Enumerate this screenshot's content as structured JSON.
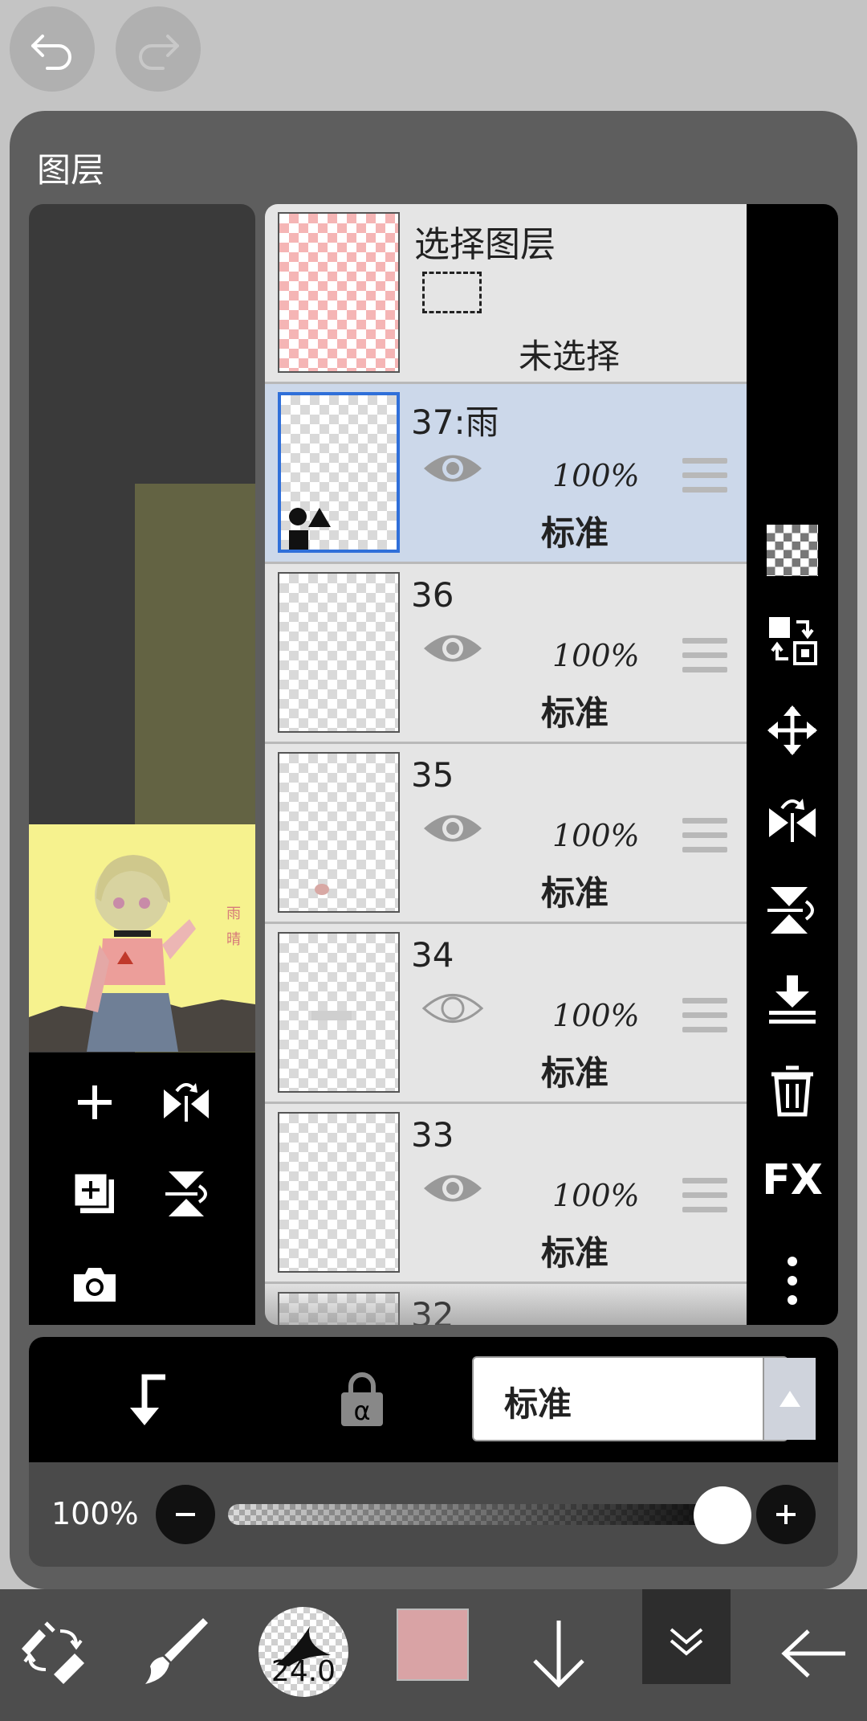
{
  "header": {
    "undo_icon": "undo-icon",
    "redo_icon": "redo-icon"
  },
  "panel": {
    "title": "图层"
  },
  "selection_layer": {
    "title": "选择图层",
    "status": "未选择"
  },
  "layers": [
    {
      "name": "37:雨",
      "opacity": "100%",
      "mode": "标准",
      "visible": true,
      "selected": true
    },
    {
      "name": "36",
      "opacity": "100%",
      "mode": "标准",
      "visible": true,
      "selected": false
    },
    {
      "name": "35",
      "opacity": "100%",
      "mode": "标准",
      "visible": true,
      "selected": false
    },
    {
      "name": "34",
      "opacity": "100%",
      "mode": "标准",
      "visible": false,
      "selected": false
    },
    {
      "name": "33",
      "opacity": "100%",
      "mode": "标准",
      "visible": true,
      "selected": false
    },
    {
      "name": "32"
    }
  ],
  "artwork": {
    "caption": "雨晴"
  },
  "right_tools": {
    "fx_label": "FX"
  },
  "blend": {
    "mode": "标准"
  },
  "opacity_control": {
    "label": "100%",
    "value": 1.0
  },
  "bottom_toolbar": {
    "brush_size": "24.0",
    "color": "#d9a3a5"
  },
  "colors": {
    "selected_row": "#ccd8ea",
    "selected_border": "#2f6fd9",
    "panel_bg": "#5e5e5e"
  }
}
